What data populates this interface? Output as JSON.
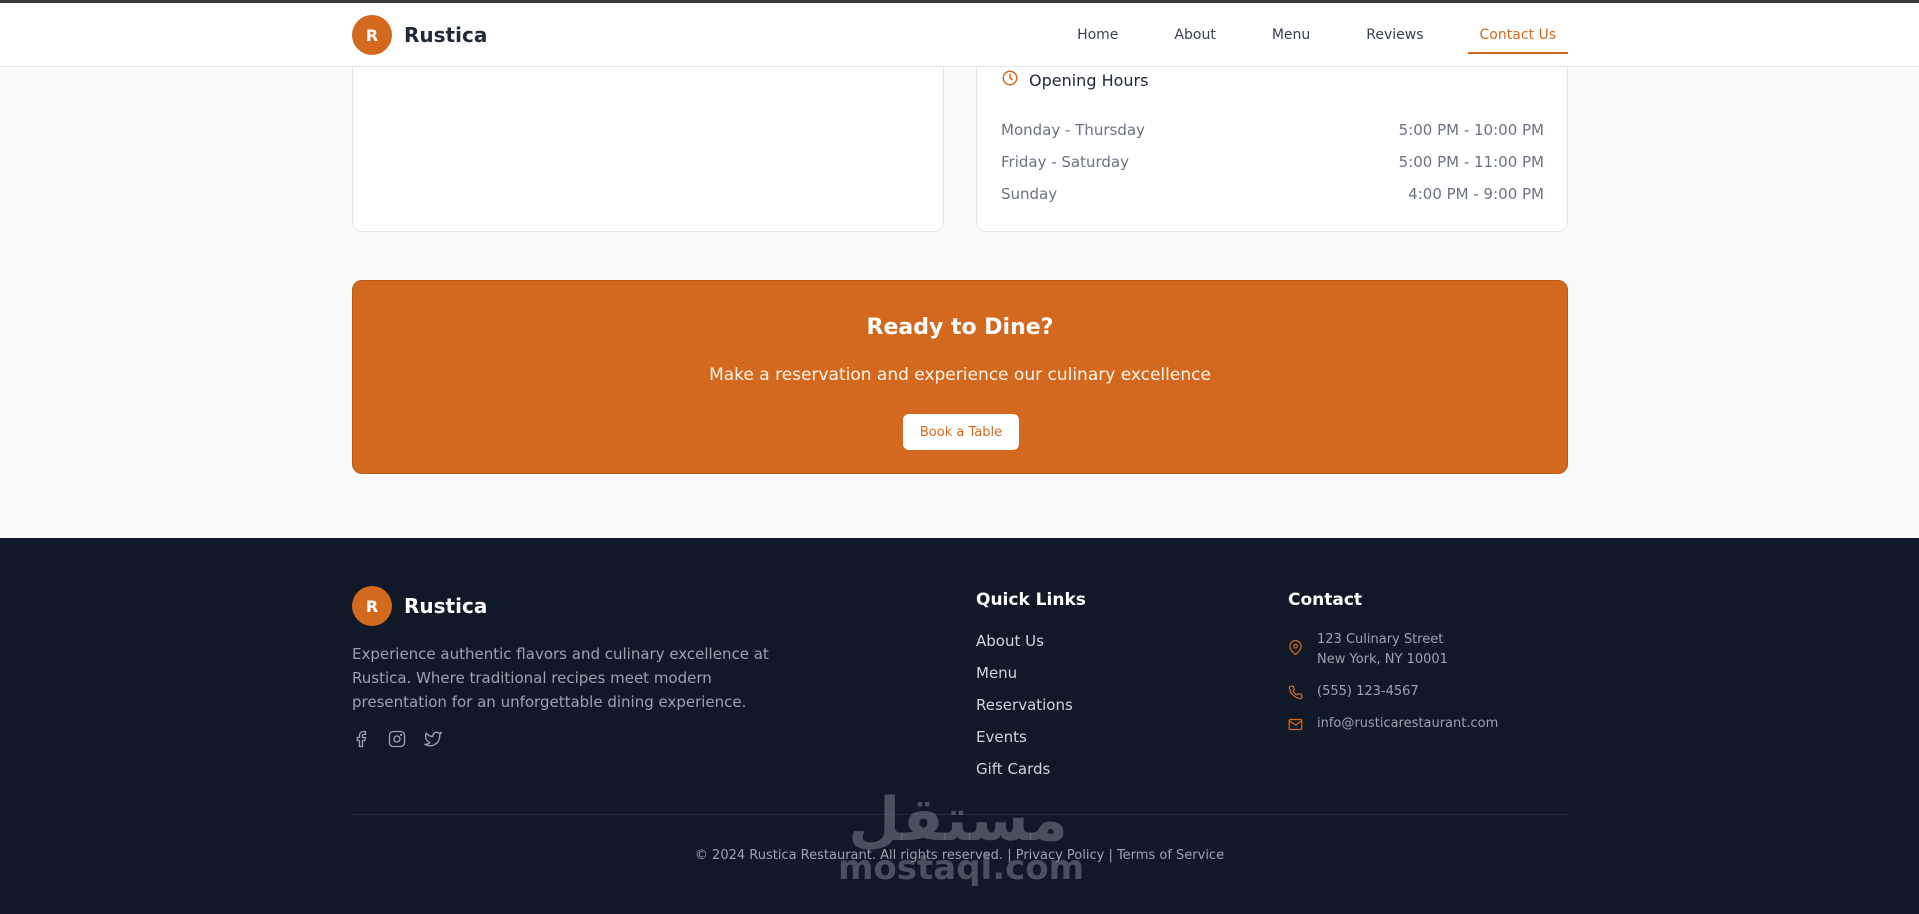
{
  "header": {
    "logo_letter": "R",
    "brand": "Rustica",
    "nav": [
      "Home",
      "About",
      "Menu",
      "Reviews",
      "Contact Us"
    ],
    "active_nav": "Contact Us"
  },
  "hours": {
    "title": "Opening Hours",
    "rows": [
      {
        "day": "Monday - Thursday",
        "time": "5:00 PM - 10:00 PM"
      },
      {
        "day": "Friday - Saturday",
        "time": "5:00 PM - 11:00 PM"
      },
      {
        "day": "Sunday",
        "time": "4:00 PM - 9:00 PM"
      }
    ]
  },
  "cta": {
    "title": "Ready to Dine?",
    "subtitle": "Make a reservation and experience our culinary excellence",
    "button": "Book a Table"
  },
  "footer": {
    "logo_letter": "R",
    "brand": "Rustica",
    "description": "Experience authentic flavors and culinary excellence at Rustica. Where traditional recipes meet modern presentation for an unforgettable dining experience.",
    "socials": [
      "facebook-icon",
      "instagram-icon",
      "twitter-icon"
    ],
    "quick_links_title": "Quick Links",
    "quick_links": [
      "About Us",
      "Menu",
      "Reservations",
      "Events",
      "Gift Cards"
    ],
    "contact_title": "Contact",
    "address_line1": "123 Culinary Street",
    "address_line2": "New York, NY 10001",
    "phone": "(555) 123-4567",
    "email": "info@rusticarestaurant.com",
    "copyright": "© 2024 Rustica Restaurant. All rights reserved. | Privacy Policy | Terms of Service"
  },
  "watermark": {
    "arabic": "مستقل",
    "latin": "mostaql.com"
  },
  "colors": {
    "accent": "#d2691e",
    "footer_bg": "#111827",
    "page_bg": "#f8f9fb"
  }
}
